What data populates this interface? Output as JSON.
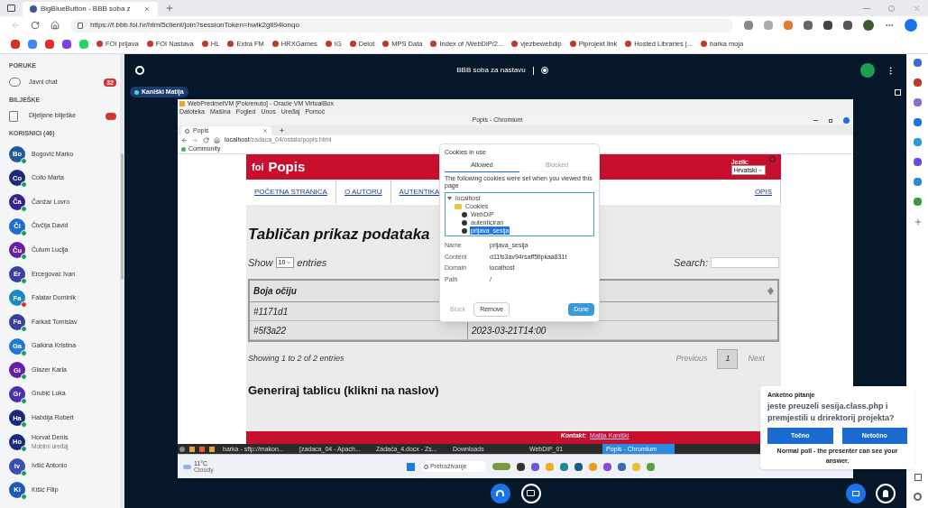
{
  "browser": {
    "tab_title": "BigBlueButton - BBB soba z",
    "url": "https://f.bbb.foi.hr/html5client/join?sessionToken=hwik2gti94ionqo",
    "bookmarks": [
      "FOI prijava",
      "FOI Nastava",
      "HL",
      "Extra FM",
      "HRXGames",
      "IG",
      "Delot",
      "MPS Data",
      "Index of /WebDiP/2...",
      "vjezbewebdip",
      "Piprojekt link",
      "Hosted Libraries |...",
      "barka moja"
    ]
  },
  "sidebar": {
    "messages_heading": "PORUKE",
    "public_chat": {
      "label": "Javni chat",
      "badge": "32"
    },
    "notes_heading": "BILJEŠKE",
    "shared_notes": {
      "label": "Dijeljene bilješke"
    },
    "users_heading": "KORISNICI (46)",
    "users": [
      {
        "initials": "Bo",
        "name": "Bogović Marko",
        "color": "#1e5a9c",
        "muted": false
      },
      {
        "initials": "Co",
        "name": "Collo Marta",
        "color": "#1f2a7a",
        "muted": false
      },
      {
        "initials": "Ča",
        "name": "Čanžar Lovro",
        "color": "#3a1f8a",
        "muted": false
      },
      {
        "initials": "Či",
        "name": "Čivčija David",
        "color": "#1e6fc9",
        "muted": false
      },
      {
        "initials": "Ču",
        "name": "Čulum Lucija",
        "color": "#6a1fa0",
        "muted": false
      },
      {
        "initials": "Er",
        "name": "Ercegovac Ivan",
        "color": "#3a3fa0",
        "muted": false
      },
      {
        "initials": "Fa",
        "name": "Falatar Dominik",
        "color": "#1a8ac0",
        "muted": true
      },
      {
        "initials": "Fa",
        "name": "Farkaš Tomislav",
        "color": "#3a3f9a",
        "muted": false
      },
      {
        "initials": "Ga",
        "name": "Galkina Kristina",
        "color": "#1e7ad0",
        "muted": false
      },
      {
        "initials": "Gl",
        "name": "Glazer Karla",
        "color": "#6a1fa1",
        "muted": false
      },
      {
        "initials": "Gr",
        "name": "Grubić Luka",
        "color": "#4a2fb0",
        "muted": false
      },
      {
        "initials": "Ha",
        "name": "Habdija Robert",
        "color": "#1a2a7a",
        "muted": false
      },
      {
        "initials": "Ho",
        "name": "Horvat Denis",
        "subtitle": "Mobilni uređaj",
        "color": "#1a2a7b",
        "muted": false
      },
      {
        "initials": "Iv",
        "name": "Ivšić Antonio",
        "color": "#3a4fb0",
        "muted": false
      },
      {
        "initials": "Ki",
        "name": "Kišić Filip",
        "color": "#1e5ab0",
        "muted": false
      }
    ]
  },
  "session": {
    "title": "BBB soba za nastavu",
    "presenter": "Kaniški Matija"
  },
  "screen_share": {
    "vm_title": "WebPredmetVM [Pokrenuto] - Oracle VM VirtualBox",
    "vm_menu": [
      "Datoteka",
      "Mašina",
      "Pogled",
      "Unos",
      "Uređaj",
      "Pomoć"
    ],
    "window_title": "Popis - Chromium",
    "tab": "Popis",
    "url_host": "localhost",
    "url_path": "/zadaca_04/ostalo/popis.html",
    "bookmark": "Community",
    "page": {
      "logo": "foi",
      "title": "Popis",
      "language_label": "Jezik:",
      "language": "Hrvatski",
      "nav": [
        "POČETNA STRANICA",
        "O AUTORU",
        "AUTENTIKA",
        "OPIS"
      ],
      "heading": "Tabličan prikaz podataka",
      "show": "Show",
      "page_size": "10",
      "entries": "entries",
      "search_label": "Search:",
      "column": "Boja očiju",
      "rows": [
        {
          "col1": "#1171d1",
          "col2": ""
        },
        {
          "col1": "#5f3a22",
          "col2": "2023-03-21T14:00"
        }
      ],
      "info": "Showing 1 to 2 of 2 entries",
      "pagination": [
        {
          "label": "Previous",
          "selected": false
        },
        {
          "label": "1",
          "selected": true
        },
        {
          "label": "Next",
          "selected": false
        }
      ],
      "heading2": "Generiraj tablicu (klikni na naslov)",
      "contact_label": "Kontakt:",
      "contact_link": "Matija Kaniški"
    },
    "cookies_dialog": {
      "title": "Cookies in use",
      "tabs": [
        {
          "label": "Allowed",
          "selected": true
        },
        {
          "label": "Blocked",
          "selected": false
        }
      ],
      "intro": "The following cookies were set when you viewed this page",
      "tree": [
        {
          "label": "localhost",
          "kind": "site",
          "selected": false,
          "children": [
            {
              "label": "Cookies",
              "kind": "folder",
              "selected": false,
              "children": [
                {
                  "label": "WebDiP",
                  "kind": "cookie",
                  "selected": false
                },
                {
                  "label": "autenticiran",
                  "kind": "cookie",
                  "selected": false
                },
                {
                  "label": "prijava_sesija",
                  "kind": "cookie",
                  "selected": true
                }
              ]
            }
          ]
        }
      ],
      "details": [
        {
          "label": "Name",
          "value": "prijava_sesija"
        },
        {
          "label": "Content",
          "value": "d11fs3av94rsaff5tlpkaa831t"
        },
        {
          "label": "Domain",
          "value": "localhost"
        },
        {
          "label": "Path",
          "value": "/"
        }
      ],
      "buttons": [
        {
          "label": "Block",
          "disabled": true,
          "primary": false
        },
        {
          "label": "Remove",
          "disabled": false,
          "primary": false
        },
        {
          "label": "Done",
          "disabled": false,
          "primary": true
        }
      ]
    },
    "linux_taskbar": [
      {
        "label": "barka - sftp://makon...",
        "selected": false
      },
      {
        "label": "[zadaca_04 - Apach...",
        "selected": false
      },
      {
        "label": "Zadaća_4.docx - Zs...",
        "selected": false
      },
      {
        "label": "Downloads",
        "selected": false
      },
      {
        "label": "WebDiP_01",
        "selected": false
      },
      {
        "label": "Popis - Chromium",
        "selected": true
      }
    ],
    "weather": {
      "temp": "11°C",
      "condition": "Cloudy"
    },
    "windows_search": "Pretraživanje"
  },
  "poll": {
    "heading": "Anketno pitanje",
    "question": "jeste preuzeli sesija.class.php i premjestili u drirektorij projekta?",
    "answers": [
      "Točno",
      "Netočno"
    ],
    "note": "Normal poll - the presenter can see your answer."
  }
}
